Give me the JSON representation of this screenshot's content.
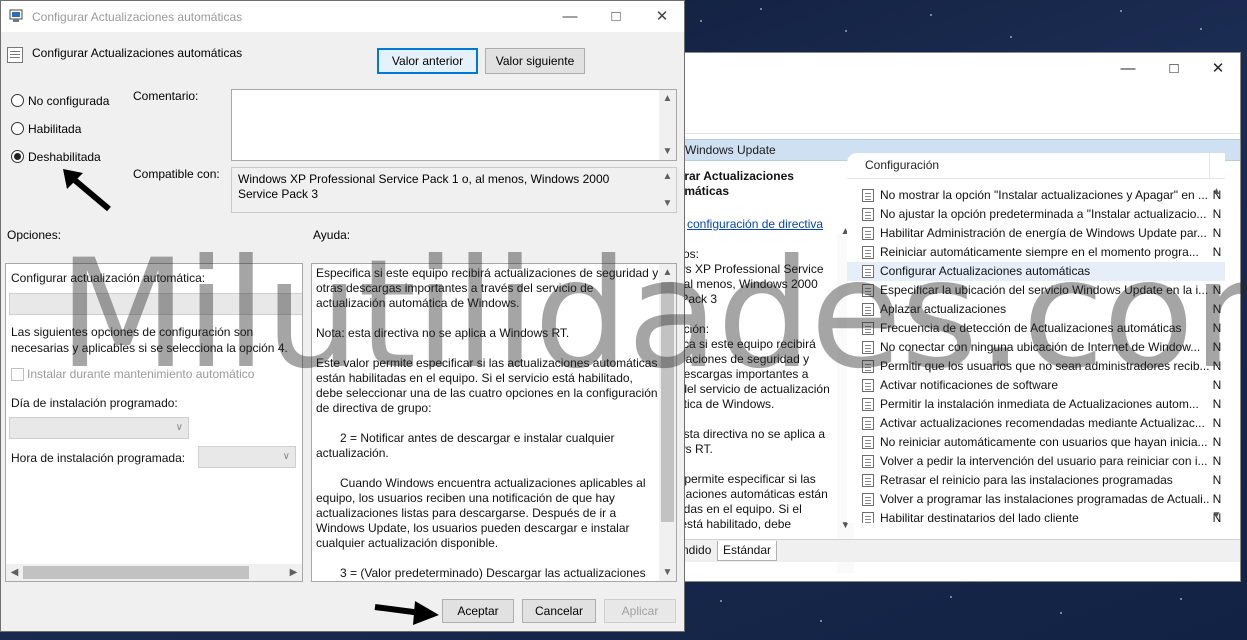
{
  "desktop": {},
  "bg_window": {
    "header_band": "Windows Update",
    "left_heading": "urar Actualizaciones\nomáticas",
    "left_link": "configuración de directiva",
    "left_req_label": "itos:",
    "left_req_text": "ws XP Professional Service\n, al menos, Windows 2000\n Pack 3",
    "left_desc_label": "pción:",
    "left_desc_text": "fica si este equipo recibirá\nizaciones de seguridad y\ndescargas importantes a\n del servicio de actualización\nática de Windows.",
    "left_note": "esta directiva no se aplica a\nws RT.",
    "left_more": "r permite especificar si las\nizaciones automáticas están\nadas en el equipo. Si el\n está habilitado, debe\n",
    "column_header": "Configuración",
    "rows": [
      {
        "text": "No mostrar la opción \"Instalar actualizaciones y Apagar\" en ...",
        "state": "N"
      },
      {
        "text": "No ajustar la opción predeterminada a \"Instalar actualizacio...",
        "state": "N"
      },
      {
        "text": "Habilitar Administración de energía de Windows Update par...",
        "state": "N"
      },
      {
        "text": "Reiniciar automáticamente siempre en el momento progra...",
        "state": "N"
      },
      {
        "text": "Configurar Actualizaciones automáticas",
        "state": ""
      },
      {
        "text": "Especificar la ubicación del servicio Windows Update en la i...",
        "state": "N"
      },
      {
        "text": "Aplazar actualizaciones",
        "state": "N"
      },
      {
        "text": "Frecuencia de detección de Actualizaciones automáticas",
        "state": "N"
      },
      {
        "text": "No conectar con ninguna ubicación de Internet de Window...",
        "state": "N"
      },
      {
        "text": "Permitir que los usuarios que no sean administradores recib...",
        "state": "N"
      },
      {
        "text": "Activar notificaciones de software",
        "state": "N"
      },
      {
        "text": "Permitir la instalación inmediata de Actualizaciones autom...",
        "state": "N"
      },
      {
        "text": "Activar actualizaciones recomendadas mediante Actualizac...",
        "state": "N"
      },
      {
        "text": "No reiniciar automáticamente con usuarios que hayan inicia...",
        "state": "N"
      },
      {
        "text": "Volver a pedir la intervención del usuario para reiniciar con i...",
        "state": "N"
      },
      {
        "text": "Retrasar el reinicio para las instalaciones programadas",
        "state": "N"
      },
      {
        "text": "Volver a programar las instalaciones programadas de Actuali...",
        "state": "N"
      },
      {
        "text": "Habilitar destinatarios del lado cliente",
        "state": "N"
      }
    ],
    "tabs": [
      "ndido",
      "Estándar"
    ]
  },
  "dialog": {
    "title": "Configurar Actualizaciones automáticas",
    "policy_name": "Configurar Actualizaciones automáticas",
    "prev_button": "Valor anterior",
    "next_button": "Valor siguiente",
    "radios": [
      {
        "label": "No configurada",
        "checked": false
      },
      {
        "label": "Habilitada",
        "checked": false
      },
      {
        "label": "Deshabilitada",
        "checked": true
      }
    ],
    "comment_label": "Comentario:",
    "comment_value": "",
    "supported_label": "Compatible con:",
    "supported_value": "Windows XP Professional Service Pack 1 o, al menos, Windows 2000 Service Pack 3",
    "options_label": "Opciones:",
    "help_label": "Ayuda:",
    "options": {
      "configure_label": "Configurar actualización automática:",
      "info_text": "Las siguientes opciones de configuración son necesarias y aplicables si se selecciona la opción 4.",
      "install_checkbox": "Instalar durante mantenimiento automático",
      "day_label": "Día de instalación programado:",
      "hour_label": "Hora de instalación programada:"
    },
    "help_paragraphs": [
      {
        "text": "Especifica si este equipo recibirá actualizaciones de seguridad y otras descargas importantes a través del servicio de actualización automática de Windows.",
        "indent": false
      },
      {
        "text": "Nota: esta directiva no se aplica a Windows RT.",
        "indent": false
      },
      {
        "text": "Este valor permite especificar si las actualizaciones automáticas están habilitadas en el equipo. Si el servicio está habilitado, debe seleccionar una de las cuatro opciones en la configuración de directiva de grupo:",
        "indent": false
      },
      {
        "text": "2 = Notificar antes de descargar e instalar cualquier actualización.",
        "indent": true
      },
      {
        "text": "Cuando Windows encuentra actualizaciones aplicables al equipo, los usuarios reciben una notificación de que hay actualizaciones listas para descargarse. Después de ir a Windows Update, los usuarios pueden descargar e instalar cualquier actualización disponible.",
        "indent": true
      },
      {
        "text": "3 = (Valor predeterminado) Descargar las actualizaciones",
        "indent": true
      }
    ],
    "ok_button": "Aceptar",
    "cancel_button": "Cancelar",
    "apply_button": "Aplicar"
  },
  "watermark": "Milutilidades.com",
  "colors": {
    "accent": "#0078d7",
    "selection": "#e5eef9",
    "header_band": "#cfe0f2"
  },
  "icons": [
    "minimize-icon",
    "maximize-icon",
    "close-icon",
    "arrow-pointer-icon"
  ]
}
